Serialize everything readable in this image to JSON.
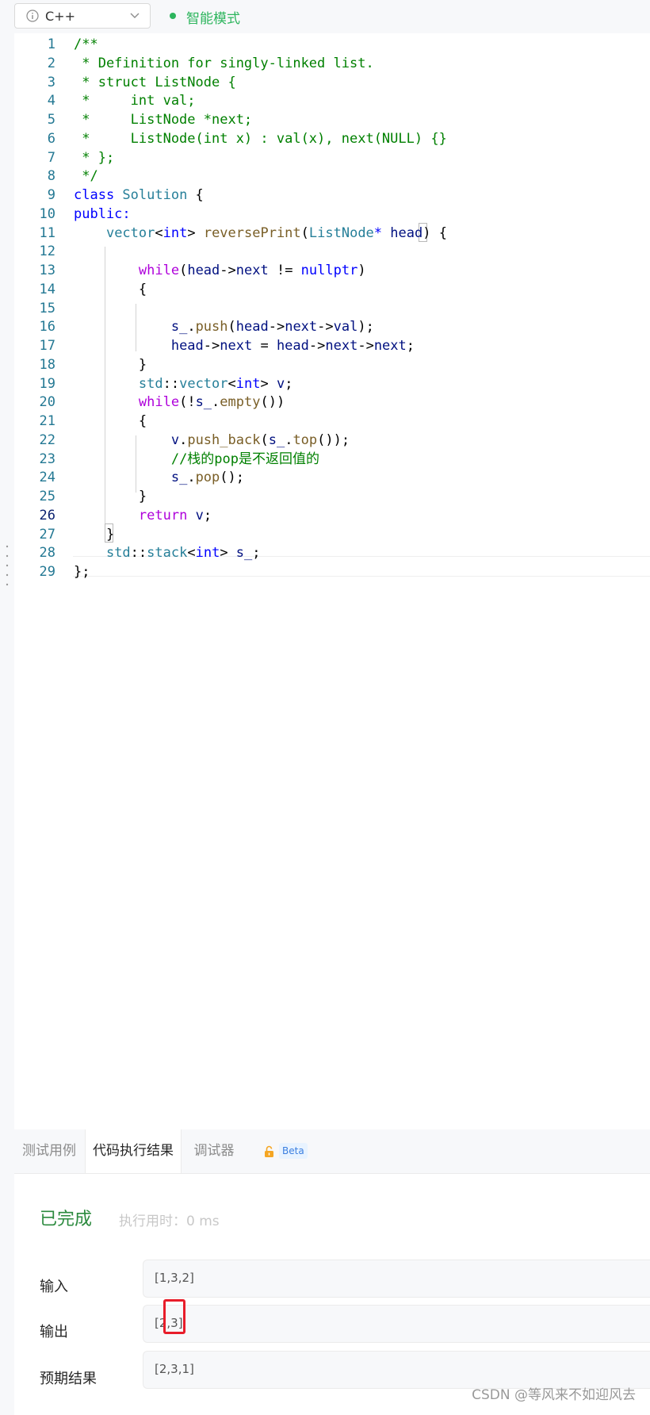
{
  "toolbar": {
    "language": "C++",
    "mode_label": "智能模式",
    "mode_color": "#2db55d"
  },
  "editor": {
    "active_line": 26,
    "lines": [
      [
        {
          "t": "/**",
          "c": "cm"
        }
      ],
      [
        {
          "t": " * Definition for singly-linked list.",
          "c": "cm"
        }
      ],
      [
        {
          "t": " * struct ListNode {",
          "c": "cm"
        }
      ],
      [
        {
          "t": " *     int val;",
          "c": "cm"
        }
      ],
      [
        {
          "t": " *     ListNode *next;",
          "c": "cm"
        }
      ],
      [
        {
          "t": " *     ListNode(int x) : val(x), next(NULL) {}",
          "c": "cm"
        }
      ],
      [
        {
          "t": " * };",
          "c": "cm"
        }
      ],
      [
        {
          "t": " */",
          "c": "cm"
        }
      ],
      [
        {
          "t": "class ",
          "c": "kw"
        },
        {
          "t": "Solution",
          "c": "ty"
        },
        {
          "t": " {",
          "c": "p"
        }
      ],
      [
        {
          "t": "public:",
          "c": "kw"
        }
      ],
      [
        {
          "t": "    ",
          "c": "p"
        },
        {
          "t": "vector",
          "c": "ty"
        },
        {
          "t": "<",
          "c": "p"
        },
        {
          "t": "int",
          "c": "kw"
        },
        {
          "t": "> ",
          "c": "p"
        },
        {
          "t": "reversePrint",
          "c": "fn"
        },
        {
          "t": "(",
          "c": "p"
        },
        {
          "t": "ListNode",
          "c": "ty"
        },
        {
          "t": "* ",
          "c": "kw"
        },
        {
          "t": "head",
          "c": "var"
        },
        {
          "t": ") {",
          "c": "p"
        }
      ],
      [],
      [
        {
          "t": "        ",
          "c": "p"
        },
        {
          "t": "while",
          "c": "ctl"
        },
        {
          "t": "(",
          "c": "p"
        },
        {
          "t": "head",
          "c": "var"
        },
        {
          "t": "->",
          "c": "p"
        },
        {
          "t": "next",
          "c": "var"
        },
        {
          "t": " != ",
          "c": "p"
        },
        {
          "t": "nullptr",
          "c": "kw"
        },
        {
          "t": ")",
          "c": "p"
        }
      ],
      [
        {
          "t": "        {",
          "c": "p"
        }
      ],
      [],
      [
        {
          "t": "            ",
          "c": "p"
        },
        {
          "t": "s_",
          "c": "var"
        },
        {
          "t": ".",
          "c": "p"
        },
        {
          "t": "push",
          "c": "fn"
        },
        {
          "t": "(",
          "c": "p"
        },
        {
          "t": "head",
          "c": "var"
        },
        {
          "t": "->",
          "c": "p"
        },
        {
          "t": "next",
          "c": "var"
        },
        {
          "t": "->",
          "c": "p"
        },
        {
          "t": "val",
          "c": "var"
        },
        {
          "t": ");",
          "c": "p"
        }
      ],
      [
        {
          "t": "            ",
          "c": "p"
        },
        {
          "t": "head",
          "c": "var"
        },
        {
          "t": "->",
          "c": "p"
        },
        {
          "t": "next",
          "c": "var"
        },
        {
          "t": " = ",
          "c": "p"
        },
        {
          "t": "head",
          "c": "var"
        },
        {
          "t": "->",
          "c": "p"
        },
        {
          "t": "next",
          "c": "var"
        },
        {
          "t": "->",
          "c": "p"
        },
        {
          "t": "next",
          "c": "var"
        },
        {
          "t": ";",
          "c": "p"
        }
      ],
      [
        {
          "t": "        }",
          "c": "p"
        }
      ],
      [
        {
          "t": "        ",
          "c": "p"
        },
        {
          "t": "std",
          "c": "ty"
        },
        {
          "t": "::",
          "c": "p"
        },
        {
          "t": "vector",
          "c": "ty"
        },
        {
          "t": "<",
          "c": "p"
        },
        {
          "t": "int",
          "c": "kw"
        },
        {
          "t": "> ",
          "c": "p"
        },
        {
          "t": "v",
          "c": "var"
        },
        {
          "t": ";",
          "c": "p"
        }
      ],
      [
        {
          "t": "        ",
          "c": "p"
        },
        {
          "t": "while",
          "c": "ctl"
        },
        {
          "t": "(!",
          "c": "p"
        },
        {
          "t": "s_",
          "c": "var"
        },
        {
          "t": ".",
          "c": "p"
        },
        {
          "t": "empty",
          "c": "fn"
        },
        {
          "t": "())",
          "c": "p"
        }
      ],
      [
        {
          "t": "        {",
          "c": "p"
        }
      ],
      [
        {
          "t": "            ",
          "c": "p"
        },
        {
          "t": "v",
          "c": "var"
        },
        {
          "t": ".",
          "c": "p"
        },
        {
          "t": "push_back",
          "c": "fn"
        },
        {
          "t": "(",
          "c": "p"
        },
        {
          "t": "s_",
          "c": "var"
        },
        {
          "t": ".",
          "c": "p"
        },
        {
          "t": "top",
          "c": "fn"
        },
        {
          "t": "());",
          "c": "p"
        }
      ],
      [
        {
          "t": "            ",
          "c": "p"
        },
        {
          "t": "//栈的pop是不返回值的",
          "c": "cm"
        }
      ],
      [
        {
          "t": "            ",
          "c": "p"
        },
        {
          "t": "s_",
          "c": "var"
        },
        {
          "t": ".",
          "c": "p"
        },
        {
          "t": "pop",
          "c": "fn"
        },
        {
          "t": "();",
          "c": "p"
        }
      ],
      [
        {
          "t": "        }",
          "c": "p"
        }
      ],
      [
        {
          "t": "        ",
          "c": "p"
        },
        {
          "t": "return",
          "c": "ctl"
        },
        {
          "t": " ",
          "c": "p"
        },
        {
          "t": "v",
          "c": "var"
        },
        {
          "t": ";",
          "c": "p"
        }
      ],
      [
        {
          "t": "    }",
          "c": "p"
        }
      ],
      [
        {
          "t": "    ",
          "c": "p"
        },
        {
          "t": "std",
          "c": "ty"
        },
        {
          "t": "::",
          "c": "p"
        },
        {
          "t": "stack",
          "c": "ty"
        },
        {
          "t": "<",
          "c": "p"
        },
        {
          "t": "int",
          "c": "kw"
        },
        {
          "t": "> ",
          "c": "p"
        },
        {
          "t": "s_",
          "c": "var"
        },
        {
          "t": ";",
          "c": "p"
        }
      ],
      [
        {
          "t": "};",
          "c": "p"
        }
      ]
    ]
  },
  "tabs": [
    {
      "label": "测试用例",
      "active": false
    },
    {
      "label": "代码执行结果",
      "active": true
    },
    {
      "label": "调试器",
      "active": false
    }
  ],
  "debugger_badge": "Beta",
  "result": {
    "status": "已完成",
    "runtime": "执行用时：0 ms",
    "rows": [
      {
        "label": "输入",
        "value": "[1,3,2]"
      },
      {
        "label": "输出",
        "value": "[2,3]"
      },
      {
        "label": "预期结果",
        "value": "[2,3,1]"
      }
    ]
  },
  "watermark": "CSDN @等风来不如迎风去",
  "colors": {
    "comment": "#008000",
    "keyword": "#0000ff",
    "control": "#af00db",
    "type": "#267f99",
    "function": "#795e26",
    "variable": "#001080",
    "line_number": "#237893",
    "status_done": "#2b8a3e",
    "highlight": "#e81d2a"
  }
}
